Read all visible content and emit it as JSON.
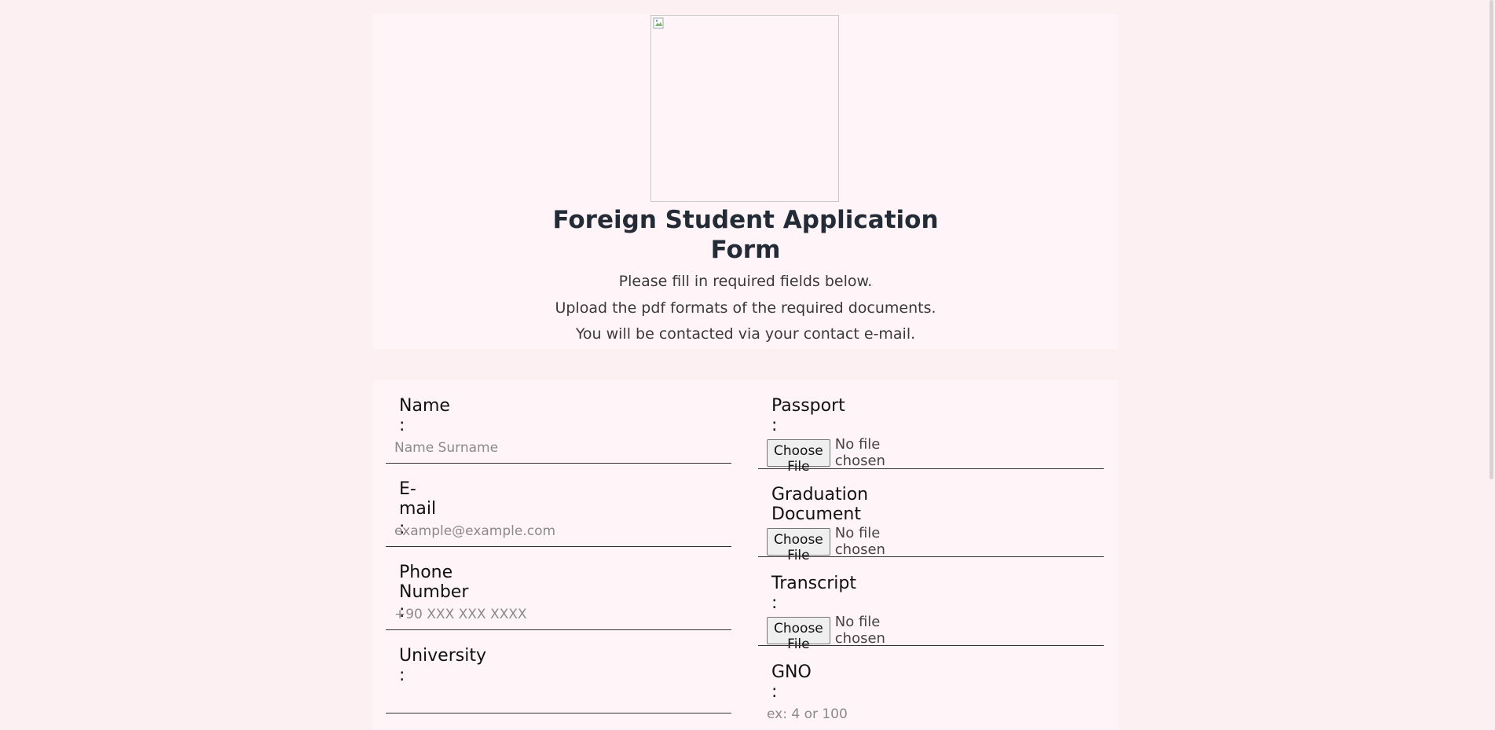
{
  "header": {
    "title_line1": "Foreign Student Application",
    "title_line2": "Form",
    "desc1": "Please fill in required fields below.",
    "desc2": "Upload the pdf formats of the required documents.",
    "desc3": "You will be contacted via your contact e-mail."
  },
  "form": {
    "name": {
      "label": "Name :",
      "placeholder": "Name Surname",
      "value": ""
    },
    "email": {
      "label": "E-mail :",
      "placeholder": "example@example.com",
      "value": ""
    },
    "phone": {
      "label": "Phone Number :",
      "placeholder": "+90 XXX XXX XXXX",
      "value": ""
    },
    "university": {
      "label": "University :",
      "value": ""
    },
    "passport": {
      "label": "Passport :",
      "button": "Choose File",
      "status": "No file chosen"
    },
    "graduation": {
      "label": "Graduation Document :",
      "button": "Choose File",
      "status": "No file chosen"
    },
    "transcript": {
      "label": "Transcript :",
      "button": "Choose File",
      "status": "No file chosen"
    },
    "gno": {
      "label": "GNO :",
      "placeholder": "ex: 4 or 100",
      "value": ""
    }
  },
  "colors": {
    "background": "#fdf0f3",
    "card": "#fff4f7",
    "underline": "#333333"
  }
}
